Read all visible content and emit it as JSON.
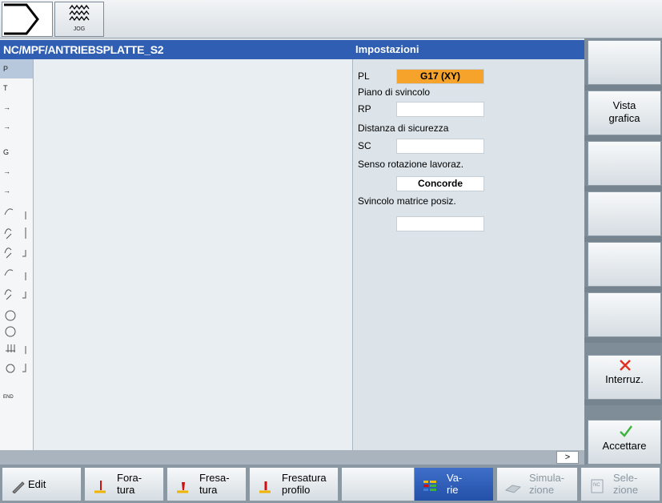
{
  "topbar": {
    "jog_label": "JOG"
  },
  "header": {
    "program_path": "NC/MPF/ANTRIEBSPLATTE_S2",
    "form_title": "Impostazioni"
  },
  "gutter": {
    "lines": [
      "P",
      "T",
      "→",
      "→",
      "G",
      "→",
      "→",
      "",
      "",
      "",
      "",
      "",
      "",
      "",
      "",
      "",
      "END"
    ]
  },
  "form": {
    "pl_label": "PL",
    "pl_value": "G17 (XY)",
    "retract_plane_label": "Piano di svincolo",
    "rp_label": "RP",
    "rp_value": "",
    "safety_distance_label": "Distanza di sicurezza",
    "sc_label": "SC",
    "sc_value": "",
    "rotation_label": "Senso rotazione lavoraz.",
    "rotation_value": "Concorde",
    "pattern_retract_label": "Svincolo matrice posiz.",
    "pattern_retract_value": ""
  },
  "scroll": {
    "more_label": ">"
  },
  "vertical_softkeys": {
    "vista_1": "Vista",
    "vista_2": "grafica",
    "interrupt": "Interruz.",
    "accept": "Accettare"
  },
  "horizontal_softkeys": {
    "edit": "Edit",
    "drilling_1": "Fora-",
    "drilling_2": "tura",
    "milling_1": "Fresa-",
    "milling_2": "tura",
    "contour_1": "Fresatura",
    "contour_2": "profilo",
    "misc_1": "Va-",
    "misc_2": "rie",
    "sim_1": "Simula-",
    "sim_2": "zione",
    "sel_1": "Sele-",
    "sel_2": "zione"
  },
  "colors": {
    "title_blue": "#2f5eb3",
    "highlight_orange": "#f5a32a",
    "cancel_red": "#e0301e",
    "accept_green": "#3cb43c"
  }
}
